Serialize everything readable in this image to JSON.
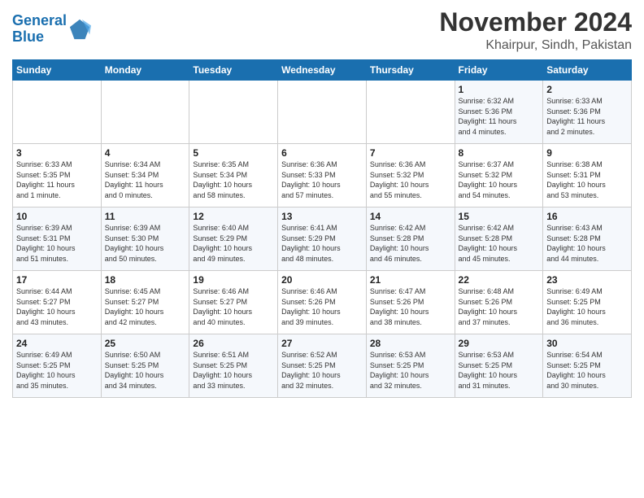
{
  "header": {
    "logo_line1": "General",
    "logo_line2": "Blue",
    "title": "November 2024",
    "subtitle": "Khairpur, Sindh, Pakistan"
  },
  "columns": [
    "Sunday",
    "Monday",
    "Tuesday",
    "Wednesday",
    "Thursday",
    "Friday",
    "Saturday"
  ],
  "weeks": [
    [
      {
        "day": "",
        "info": ""
      },
      {
        "day": "",
        "info": ""
      },
      {
        "day": "",
        "info": ""
      },
      {
        "day": "",
        "info": ""
      },
      {
        "day": "",
        "info": ""
      },
      {
        "day": "1",
        "info": "Sunrise: 6:32 AM\nSunset: 5:36 PM\nDaylight: 11 hours\nand 4 minutes."
      },
      {
        "day": "2",
        "info": "Sunrise: 6:33 AM\nSunset: 5:36 PM\nDaylight: 11 hours\nand 2 minutes."
      }
    ],
    [
      {
        "day": "3",
        "info": "Sunrise: 6:33 AM\nSunset: 5:35 PM\nDaylight: 11 hours\nand 1 minute."
      },
      {
        "day": "4",
        "info": "Sunrise: 6:34 AM\nSunset: 5:34 PM\nDaylight: 11 hours\nand 0 minutes."
      },
      {
        "day": "5",
        "info": "Sunrise: 6:35 AM\nSunset: 5:34 PM\nDaylight: 10 hours\nand 58 minutes."
      },
      {
        "day": "6",
        "info": "Sunrise: 6:36 AM\nSunset: 5:33 PM\nDaylight: 10 hours\nand 57 minutes."
      },
      {
        "day": "7",
        "info": "Sunrise: 6:36 AM\nSunset: 5:32 PM\nDaylight: 10 hours\nand 55 minutes."
      },
      {
        "day": "8",
        "info": "Sunrise: 6:37 AM\nSunset: 5:32 PM\nDaylight: 10 hours\nand 54 minutes."
      },
      {
        "day": "9",
        "info": "Sunrise: 6:38 AM\nSunset: 5:31 PM\nDaylight: 10 hours\nand 53 minutes."
      }
    ],
    [
      {
        "day": "10",
        "info": "Sunrise: 6:39 AM\nSunset: 5:31 PM\nDaylight: 10 hours\nand 51 minutes."
      },
      {
        "day": "11",
        "info": "Sunrise: 6:39 AM\nSunset: 5:30 PM\nDaylight: 10 hours\nand 50 minutes."
      },
      {
        "day": "12",
        "info": "Sunrise: 6:40 AM\nSunset: 5:29 PM\nDaylight: 10 hours\nand 49 minutes."
      },
      {
        "day": "13",
        "info": "Sunrise: 6:41 AM\nSunset: 5:29 PM\nDaylight: 10 hours\nand 48 minutes."
      },
      {
        "day": "14",
        "info": "Sunrise: 6:42 AM\nSunset: 5:28 PM\nDaylight: 10 hours\nand 46 minutes."
      },
      {
        "day": "15",
        "info": "Sunrise: 6:42 AM\nSunset: 5:28 PM\nDaylight: 10 hours\nand 45 minutes."
      },
      {
        "day": "16",
        "info": "Sunrise: 6:43 AM\nSunset: 5:28 PM\nDaylight: 10 hours\nand 44 minutes."
      }
    ],
    [
      {
        "day": "17",
        "info": "Sunrise: 6:44 AM\nSunset: 5:27 PM\nDaylight: 10 hours\nand 43 minutes."
      },
      {
        "day": "18",
        "info": "Sunrise: 6:45 AM\nSunset: 5:27 PM\nDaylight: 10 hours\nand 42 minutes."
      },
      {
        "day": "19",
        "info": "Sunrise: 6:46 AM\nSunset: 5:27 PM\nDaylight: 10 hours\nand 40 minutes."
      },
      {
        "day": "20",
        "info": "Sunrise: 6:46 AM\nSunset: 5:26 PM\nDaylight: 10 hours\nand 39 minutes."
      },
      {
        "day": "21",
        "info": "Sunrise: 6:47 AM\nSunset: 5:26 PM\nDaylight: 10 hours\nand 38 minutes."
      },
      {
        "day": "22",
        "info": "Sunrise: 6:48 AM\nSunset: 5:26 PM\nDaylight: 10 hours\nand 37 minutes."
      },
      {
        "day": "23",
        "info": "Sunrise: 6:49 AM\nSunset: 5:25 PM\nDaylight: 10 hours\nand 36 minutes."
      }
    ],
    [
      {
        "day": "24",
        "info": "Sunrise: 6:49 AM\nSunset: 5:25 PM\nDaylight: 10 hours\nand 35 minutes."
      },
      {
        "day": "25",
        "info": "Sunrise: 6:50 AM\nSunset: 5:25 PM\nDaylight: 10 hours\nand 34 minutes."
      },
      {
        "day": "26",
        "info": "Sunrise: 6:51 AM\nSunset: 5:25 PM\nDaylight: 10 hours\nand 33 minutes."
      },
      {
        "day": "27",
        "info": "Sunrise: 6:52 AM\nSunset: 5:25 PM\nDaylight: 10 hours\nand 32 minutes."
      },
      {
        "day": "28",
        "info": "Sunrise: 6:53 AM\nSunset: 5:25 PM\nDaylight: 10 hours\nand 32 minutes."
      },
      {
        "day": "29",
        "info": "Sunrise: 6:53 AM\nSunset: 5:25 PM\nDaylight: 10 hours\nand 31 minutes."
      },
      {
        "day": "30",
        "info": "Sunrise: 6:54 AM\nSunset: 5:25 PM\nDaylight: 10 hours\nand 30 minutes."
      }
    ]
  ]
}
